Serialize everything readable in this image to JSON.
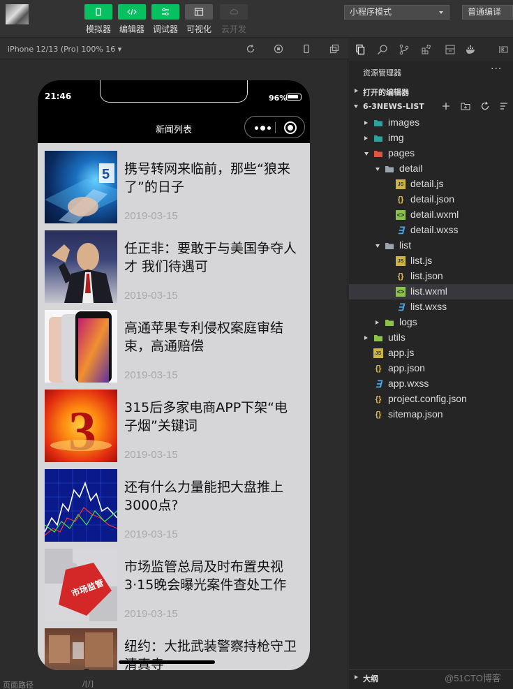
{
  "toolbar": {
    "buttons": [
      {
        "label": "模拟器",
        "icon": "phone-icon",
        "state": "active"
      },
      {
        "label": "编辑器",
        "icon": "code-icon",
        "state": "active"
      },
      {
        "label": "调试器",
        "icon": "sliders-icon",
        "state": "active"
      },
      {
        "label": "可视化",
        "icon": "layout-icon",
        "state": "normal"
      },
      {
        "label": "云开发",
        "icon": "cloud-icon",
        "state": "disabled"
      }
    ],
    "mode_select": "小程序模式",
    "compile_button": "普通编译"
  },
  "simulator": {
    "device_label": "iPhone 12/13 (Pro) 100% 16 ▾",
    "bottom_text_left": "页面路径",
    "bottom_text_mid": "/[/]"
  },
  "phone": {
    "time": "21:46",
    "battery": "96%",
    "nav_title": "新闻列表",
    "news": [
      {
        "title": "携号转网来临前，那些“狼来了”的日子",
        "date": "2019-03-15"
      },
      {
        "title": "任正非：要敢于与美国争夺人才 我们待遇可",
        "date": "2019-03-15"
      },
      {
        "title": "高通苹果专利侵权案庭审结束，高通赔偿",
        "date": "2019-03-15"
      },
      {
        "title": "315后多家电商APP下架“电子烟”关键词",
        "date": "2019-03-15"
      },
      {
        "title": "还有什么力量能把大盘推上3000点?",
        "date": "2019-03-15"
      },
      {
        "title": "市场监管总局及时布置央视3·15晚会曝光案件查处工作",
        "date": "2019-03-15"
      },
      {
        "title": "纽约：大批武装警察持枪守卫清真寺",
        "date": ""
      }
    ],
    "thumb_texts": {
      "t1": "5",
      "t4": "3",
      "t6": "市场监管"
    }
  },
  "explorer": {
    "title": "资源管理器",
    "more": "···",
    "open_editors": "打开的编辑器",
    "project": "6-3NEWS-LIST",
    "outline": "大纲",
    "watermark": "@51CTO博客",
    "tree": [
      {
        "label": "images",
        "type": "folder-img",
        "level": 1,
        "arrow": "right"
      },
      {
        "label": "img",
        "type": "folder-img",
        "level": 1,
        "arrow": "right"
      },
      {
        "label": "pages",
        "type": "folder-pages",
        "level": 1,
        "arrow": "down"
      },
      {
        "label": "detail",
        "type": "folder",
        "level": 2,
        "arrow": "down"
      },
      {
        "label": "detail.js",
        "type": "js",
        "level": 3
      },
      {
        "label": "detail.json",
        "type": "json",
        "level": 3
      },
      {
        "label": "detail.wxml",
        "type": "wxml",
        "level": 3
      },
      {
        "label": "detail.wxss",
        "type": "wxss",
        "level": 3
      },
      {
        "label": "list",
        "type": "folder",
        "level": 2,
        "arrow": "down"
      },
      {
        "label": "list.js",
        "type": "js",
        "level": 3
      },
      {
        "label": "list.json",
        "type": "json",
        "level": 3
      },
      {
        "label": "list.wxml",
        "type": "wxml",
        "level": 3,
        "selected": true
      },
      {
        "label": "list.wxss",
        "type": "wxss",
        "level": 3
      },
      {
        "label": "logs",
        "type": "folder-logs",
        "level": 2,
        "arrow": "right"
      },
      {
        "label": "utils",
        "type": "folder-utils",
        "level": 1,
        "arrow": "right"
      },
      {
        "label": "app.js",
        "type": "js",
        "level": 1
      },
      {
        "label": "app.json",
        "type": "json",
        "level": 1
      },
      {
        "label": "app.wxss",
        "type": "wxss",
        "level": 1
      },
      {
        "label": "project.config.json",
        "type": "json",
        "level": 1
      },
      {
        "label": "sitemap.json",
        "type": "json",
        "level": 1
      }
    ]
  },
  "colors": {
    "accent_green": "#07c160",
    "selected_row": "#37373d",
    "explorer_bg": "#252526"
  }
}
